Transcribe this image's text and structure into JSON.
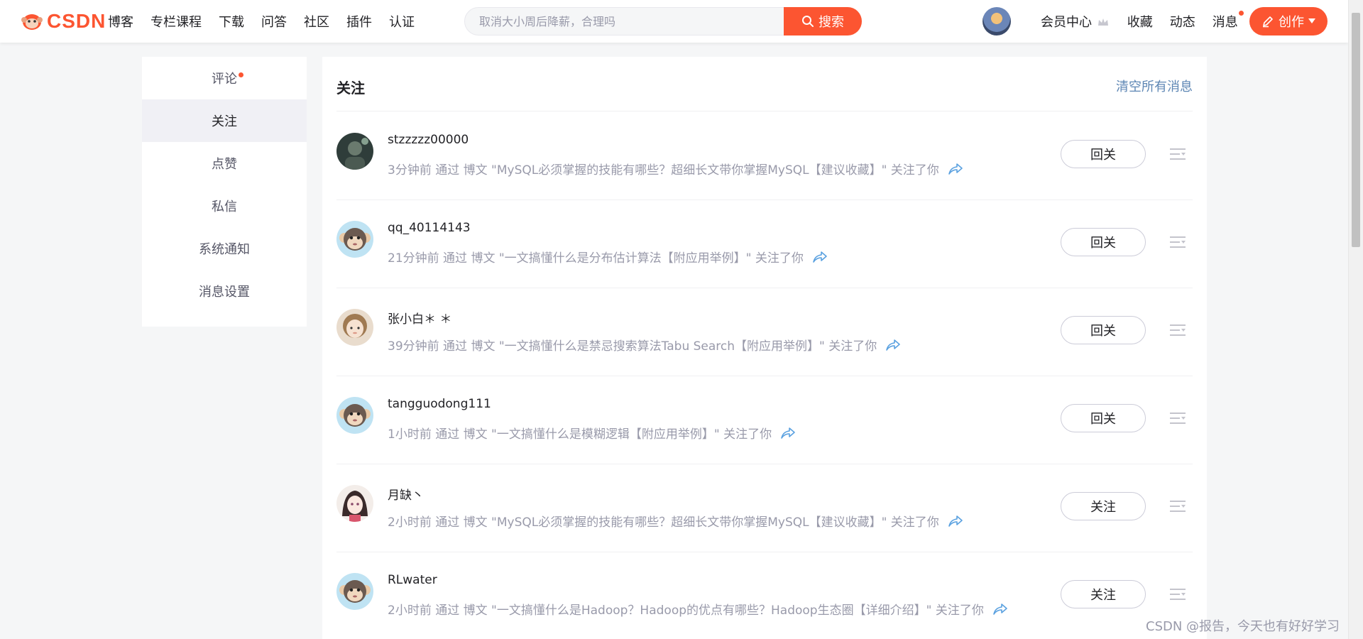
{
  "header": {
    "logo_text": "CSDN",
    "nav": [
      "博客",
      "专栏课程",
      "下载",
      "问答",
      "社区",
      "插件",
      "认证"
    ],
    "search": {
      "placeholder": "取消大小周后降薪，合理吗",
      "button_label": "搜索"
    },
    "links": {
      "vip": "会员中心",
      "favorites": "收藏",
      "dynamics": "动态",
      "messages": "消息"
    },
    "create_label": "创作"
  },
  "sidebar": {
    "items": [
      {
        "label": "评论",
        "has_dot": true
      },
      {
        "label": "关注",
        "active": true
      },
      {
        "label": "点赞"
      },
      {
        "label": "私信"
      },
      {
        "label": "系统通知"
      },
      {
        "label": "消息设置"
      }
    ]
  },
  "main": {
    "title": "关注",
    "clear_all": "清空所有消息",
    "rows": [
      {
        "name": "stzzzzz00000",
        "desc": "3分钟前 通过 博文 \"MySQL必须掌握的技能有哪些？超细长文带你掌握MySQL【建议收藏】\" 关注了你",
        "button": "回关",
        "avatar": "dark"
      },
      {
        "name": "qq_40114143",
        "desc": "21分钟前 通过 博文 \"一文搞懂什么是分布估计算法【附应用举例】\" 关注了你",
        "button": "回关",
        "avatar": "monkey"
      },
      {
        "name": "张小白＊ ＊",
        "desc": "39分钟前 通过 博文 \"一文搞懂什么是禁忌搜索算法Tabu Search【附应用举例】\" 关注了你",
        "button": "回关",
        "avatar": "girl"
      },
      {
        "name": "tangguodong111",
        "desc": "1小时前 通过 博文 \"一文搞懂什么是模糊逻辑【附应用举例】\" 关注了你",
        "button": "回关",
        "avatar": "monkey"
      },
      {
        "name": "月缺丶",
        "desc": "2小时前 通过 博文 \"MySQL必须掌握的技能有哪些？超细长文带你掌握MySQL【建议收藏】\" 关注了你",
        "button": "关注",
        "avatar": "anime"
      },
      {
        "name": "RLwater",
        "desc": "2小时前 通过 博文 \"一文搞懂什么是Hadoop？Hadoop的优点有哪些？Hadoop生态圈【详细介绍】\" 关注了你",
        "button": "关注",
        "avatar": "monkey"
      }
    ]
  },
  "watermark": "CSDN @报告，今天也有好好学习",
  "colors": {
    "brand": "#fc5531",
    "link": "#5d86b4",
    "muted": "#999aaa"
  }
}
